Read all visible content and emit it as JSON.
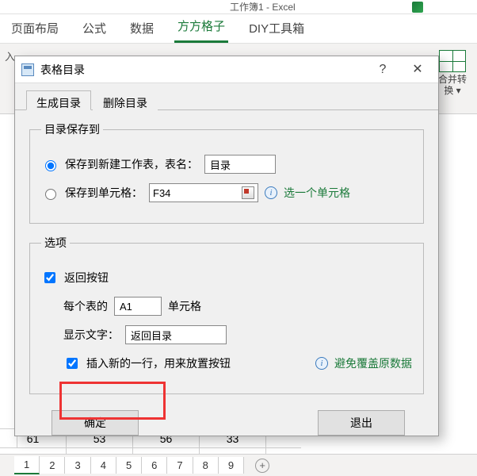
{
  "app": {
    "title": "工作簿1 - Excel"
  },
  "ribbon": {
    "tabs": [
      "页面布局",
      "公式",
      "数据",
      "方方格子",
      "DIY工具箱"
    ],
    "active_index": 3,
    "fragment": "入",
    "right_group": {
      "line1": "合并转",
      "line2": "换 ▾"
    }
  },
  "dialog": {
    "title": "表格目录",
    "help": "?",
    "close": "✕",
    "tabs": {
      "generate": "生成目录",
      "delete": "删除目录",
      "active": 0
    },
    "save_to": {
      "legend": "目录保存到",
      "radio_new_sheet_label": "保存到新建工作表，表名：",
      "new_sheet_name": "目录",
      "radio_cell_label": "保存到单元格：",
      "cell_ref": "F34",
      "pick_cell_link": "选一个单元格"
    },
    "options": {
      "legend": "选项",
      "back_button_label": "返回按钮",
      "each_sheet_prefix": "每个表的",
      "each_sheet_cell": "A1",
      "each_sheet_suffix": "单元格",
      "display_text_label": "显示文字：",
      "display_text_value": "返回目录",
      "insert_row_label": "插入新的一行，用来放置按钮",
      "avoid_overwrite_link": "避免覆盖原数据"
    },
    "buttons": {
      "ok": "确定",
      "exit": "退出"
    }
  },
  "grid": {
    "row": [
      "61",
      "53",
      "56",
      "33"
    ]
  },
  "sheets": [
    "1",
    "2",
    "3",
    "4",
    "5",
    "6",
    "7",
    "8",
    "9"
  ]
}
